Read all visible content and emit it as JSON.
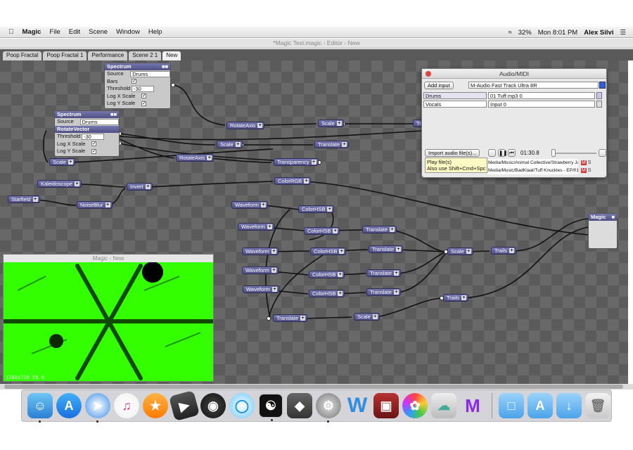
{
  "menubar": {
    "app": "Magic",
    "items": [
      "File",
      "Edit",
      "Scene",
      "Window",
      "Help"
    ],
    "battery": "32%",
    "clock": "Mon 8:01 PM",
    "user": "Alex Silvi"
  },
  "window": {
    "title": "*Magic Test.magic - Editor - New"
  },
  "tabs": [
    "Poop Fractal",
    "Poop Fractal 1",
    "Performance",
    "Scene 2 1",
    "New"
  ],
  "spectrum1": {
    "title": "Spectrum",
    "source_label": "Source",
    "source_value": "Drums",
    "bars_label": "Bars",
    "threshold_label": "Threshold",
    "threshold_value": "-30",
    "logx_label": "Log X Scale",
    "logy_label": "Log Y Scale"
  },
  "spectrum2": {
    "title": "Spectrum",
    "source_label": "Source",
    "source_value": "Drums",
    "rotate_label": "RotateVector",
    "threshold_label": "Threshold",
    "threshold_value": "-30",
    "logx_label": "Log X Scale",
    "logy_label": "Log Y Scale"
  },
  "nodes": {
    "scale_a": "Scale",
    "rotateaxis_a": "RotateAxis",
    "scale_b": "Scale",
    "tr_partial": "Tr",
    "scale_c": "Scale",
    "translate_a": "Translate",
    "rotateaxis_b": "RotateAxis",
    "transparency": "Transparency",
    "scale_d": "Scale",
    "colorrgb": "ColorRGB",
    "kaleidoscope": "Kaleidoscope",
    "invert": "Invert",
    "starfield": "Starfield",
    "noiseblur": "NoiseBlur",
    "waveform1": "Waveform",
    "waveform2": "Waveform",
    "waveform3": "Waveform",
    "waveform4": "Waveform",
    "waveform5": "Waveform",
    "colorhsb1": "ColorHSB",
    "colorhsb2": "ColorHSB",
    "colorhsb3": "ColorHSB",
    "colorhsb4": "ColorHSB",
    "colorhsb5": "ColorHSB",
    "translate1": "Translate",
    "translate2": "Translate",
    "translate3": "Translate",
    "translate4": "Translate",
    "translate5": "Translate",
    "scale_e": "Scale",
    "trails1": "Trails",
    "scale_f": "Scale",
    "trails2": "Trails",
    "magic": "Magic"
  },
  "preview": {
    "title": "Magic - New",
    "info": "1280x720 59.9"
  },
  "audio": {
    "title": "Audio/MIDI",
    "add_input": "Add input",
    "device": "M-Audio Fast Track Ultra 8R",
    "tracks": [
      {
        "name": "Drums",
        "source": "01 Tuff.mp3 0"
      },
      {
        "name": "Vocals",
        "source": "Input 0"
      }
    ],
    "import_button": "Import audio file(s)...",
    "time": "01:30.8",
    "tooltip_line1": "Play file(s)",
    "tooltip_line2": "Also use Shift+Cmd+Spc",
    "files": [
      "Media/Music/Animal Collective/Strawberry Jam/05 F...",
      "Media/Music/BadKlaat/Tuff Knuckles - EP/01 Tuff.m..."
    ]
  }
}
